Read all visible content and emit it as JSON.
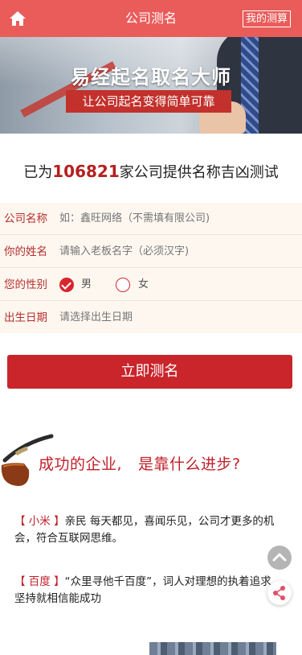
{
  "topbar": {
    "title": "公司测名",
    "my_test_label": "我的测算",
    "bg_color": "#e95c5a"
  },
  "banner": {
    "title": "易经起名取名大师",
    "subtitle": "让公司起名变得简单可靠"
  },
  "headline": {
    "prefix": "已为",
    "count": "106821",
    "suffix": "家公司提供名称吉凶测试"
  },
  "form": {
    "company": {
      "label": "公司名称",
      "placeholder": "如：鑫旺网络（不需填有限公司)"
    },
    "name": {
      "label": "你的姓名",
      "placeholder": "请输入老板名字（必须汉字)"
    },
    "gender": {
      "label": "您的性别",
      "male": "男",
      "female": "女",
      "selected": "男"
    },
    "birthday": {
      "label": "出生日期",
      "placeholder": "请选择出生日期"
    }
  },
  "submit_label": "立即测名",
  "section": {
    "title_left": "成功的企业,",
    "title_right": "是靠什么进步?",
    "items": [
      {
        "brand": "【 小米 】",
        "text": "亲民 每天都见，喜闻乐见，公司才更多的机会，符合互联网思维。"
      },
      {
        "brand": "【 百度 】",
        "text": "“众里寻他千百度”，词人对理想的执着追求，坚持就相信能成功"
      }
    ]
  },
  "colors": {
    "accent": "#c9252b",
    "brand_red": "#c0202a",
    "form_bg": "#fdf7f0"
  },
  "icons": [
    "home-icon",
    "radio-checked-icon",
    "radio-unchecked-icon",
    "pipe-illustration",
    "arrow-up-icon",
    "share-icon"
  ]
}
